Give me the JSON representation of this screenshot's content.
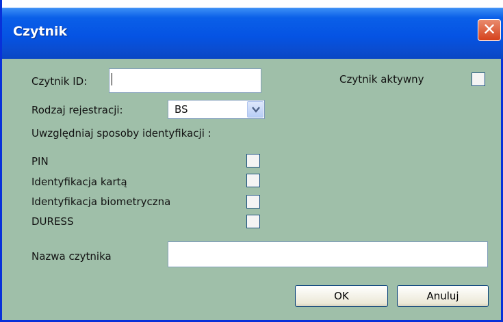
{
  "window": {
    "title": "Czytnik",
    "close_symbol": "✕"
  },
  "form": {
    "reader_id_label": "Czytnik ID:",
    "reader_id_value": "",
    "reader_active_label": "Czytnik aktywny",
    "reader_active_checked": false,
    "registration_type_label": "Rodzaj rejestracji:",
    "registration_type_value": "BS",
    "identification_heading": "Uwzględniaj sposoby identyfikacji :",
    "identification_methods": [
      {
        "label": "PIN",
        "checked": false
      },
      {
        "label": "Identyfikacja kartą",
        "checked": false
      },
      {
        "label": "Identyfikacja biometryczna",
        "checked": false
      },
      {
        "label": "DURESS",
        "checked": false
      }
    ],
    "reader_name_label": "Nazwa czytnika",
    "reader_name_value": ""
  },
  "buttons": {
    "ok_label": "OK",
    "cancel_label": "Anuluj"
  },
  "colors": {
    "dialog_background": "#9fbfa9",
    "titlebar": "#0553e3",
    "close_button": "#d5411c"
  }
}
